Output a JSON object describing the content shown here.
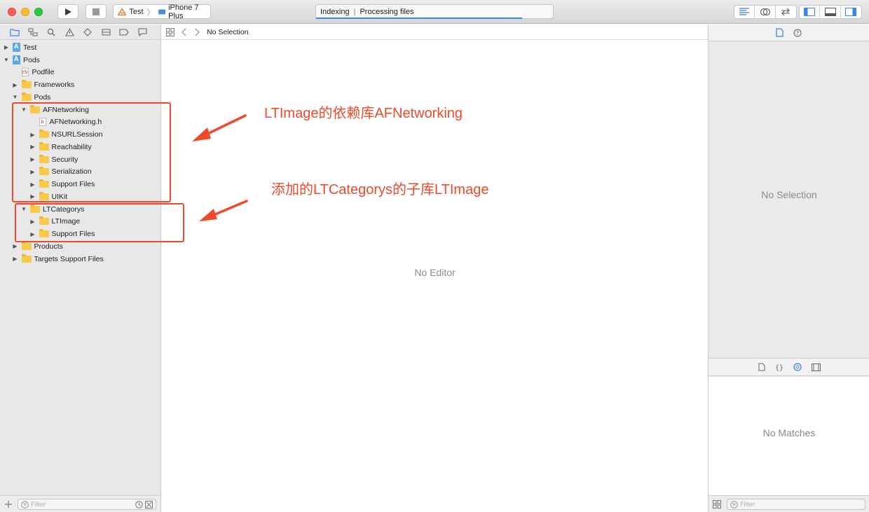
{
  "toolbar": {
    "scheme_target": "Test",
    "scheme_device": "iPhone 7 Plus",
    "activity_task": "Indexing",
    "activity_status": "Processing files",
    "activity_progress": 0.87
  },
  "navigator": {
    "tree": [
      {
        "label": "Test",
        "type": "project",
        "disclosure": "collapsed",
        "depth": 0
      },
      {
        "label": "Pods",
        "type": "project",
        "disclosure": "expanded",
        "depth": 0
      },
      {
        "label": "Podfile",
        "type": "podfile",
        "disclosure": "none",
        "depth": 1
      },
      {
        "label": "Frameworks",
        "type": "folder",
        "disclosure": "collapsed",
        "depth": 1
      },
      {
        "label": "Pods",
        "type": "folder",
        "disclosure": "expanded",
        "depth": 1
      },
      {
        "label": "AFNetworking",
        "type": "folder",
        "disclosure": "expanded",
        "depth": 2
      },
      {
        "label": "AFNetworking.h",
        "type": "header",
        "disclosure": "none",
        "depth": 3
      },
      {
        "label": "NSURLSession",
        "type": "folder",
        "disclosure": "collapsed",
        "depth": 3
      },
      {
        "label": "Reachability",
        "type": "folder",
        "disclosure": "collapsed",
        "depth": 3
      },
      {
        "label": "Security",
        "type": "folder",
        "disclosure": "collapsed",
        "depth": 3
      },
      {
        "label": "Serialization",
        "type": "folder",
        "disclosure": "collapsed",
        "depth": 3
      },
      {
        "label": "Support Files",
        "type": "folder",
        "disclosure": "collapsed",
        "depth": 3
      },
      {
        "label": "UIKit",
        "type": "folder",
        "disclosure": "collapsed",
        "depth": 3
      },
      {
        "label": "LTCategorys",
        "type": "folder",
        "disclosure": "expanded",
        "depth": 2
      },
      {
        "label": "LTImage",
        "type": "folder",
        "disclosure": "collapsed",
        "depth": 3
      },
      {
        "label": "Support Files",
        "type": "folder",
        "disclosure": "collapsed",
        "depth": 3
      },
      {
        "label": "Products",
        "type": "folder",
        "disclosure": "collapsed",
        "depth": 1
      },
      {
        "label": "Targets Support Files",
        "type": "folder",
        "disclosure": "collapsed",
        "depth": 1
      }
    ],
    "filter_placeholder": "Filter"
  },
  "jumpbar": {
    "selection": "No Selection"
  },
  "editor": {
    "empty_text": "No Editor"
  },
  "inspector": {
    "empty_text": "No Selection",
    "library_empty_text": "No Matches",
    "filter_placeholder": "Filter"
  },
  "annotations": {
    "afnetworking_note": "LTImage的依赖库AFNetworking",
    "ltcategorys_note": "添加的LTCategorys的子库LTImage",
    "color": "#ee4a2b"
  }
}
